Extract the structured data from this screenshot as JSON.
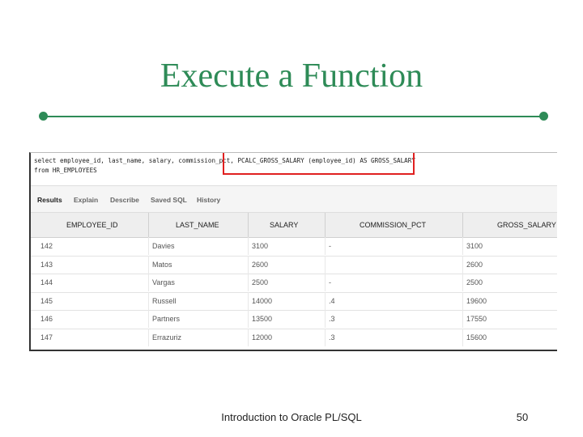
{
  "slide": {
    "title": "Execute a Function",
    "footer": "Introduction to Oracle PL/SQL",
    "page_number": "50",
    "accent_color": "#2e8b57",
    "highlight_color": "#e02020"
  },
  "sql": {
    "line1": "select employee_id, last_name, salary, commission_pct, PCALC_GROSS_SALARY (employee_id) AS GROSS_SALARY",
    "line2": "from HR_EMPLOYEES"
  },
  "tabs": [
    "Results",
    "Explain",
    "Describe",
    "Saved SQL",
    "History"
  ],
  "grid": {
    "headers": [
      "EMPLOYEE_ID",
      "LAST_NAME",
      "SALARY",
      "COMMISSION_PCT",
      "GROSS_SALARY"
    ],
    "rows": [
      [
        "142",
        "Davies",
        "3100",
        "-",
        "3100"
      ],
      [
        "143",
        "Matos",
        "2600",
        "",
        "2600"
      ],
      [
        "144",
        "Vargas",
        "2500",
        "-",
        "2500"
      ],
      [
        "145",
        "Russell",
        "14000",
        ".4",
        "19600"
      ],
      [
        "146",
        "Partners",
        "13500",
        ".3",
        "17550"
      ],
      [
        "147",
        "Errazuriz",
        "12000",
        ".3",
        "15600"
      ]
    ]
  }
}
